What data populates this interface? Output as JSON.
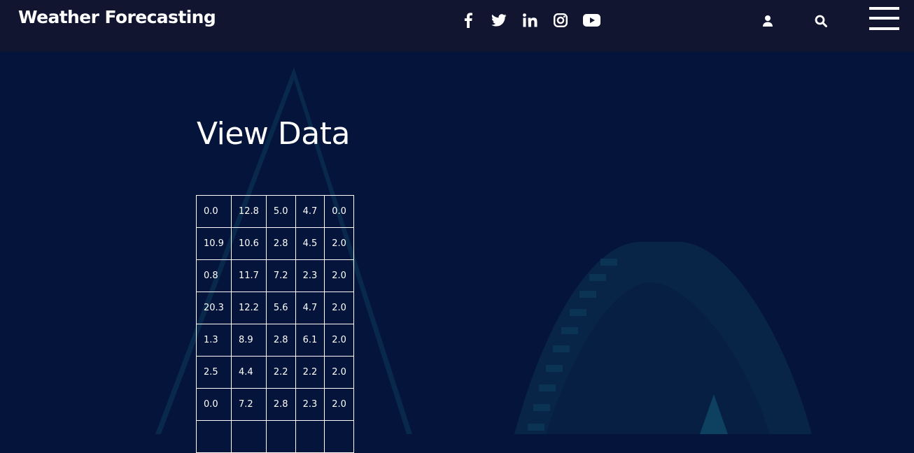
{
  "header": {
    "brand": "Weather Forecasting",
    "social_icons": [
      "facebook-icon",
      "twitter-icon",
      "linkedin-icon",
      "instagram-icon",
      "youtube-icon"
    ],
    "utility_icons": [
      "user-icon",
      "search-icon",
      "menu-icon"
    ]
  },
  "main": {
    "title": "View Data",
    "table": {
      "rows": [
        [
          "0.0",
          "12.8",
          "5.0",
          "4.7",
          "0.0"
        ],
        [
          "10.9",
          "10.6",
          "2.8",
          "4.5",
          "2.0"
        ],
        [
          "0.8",
          "11.7",
          "7.2",
          "2.3",
          "2.0"
        ],
        [
          "20.3",
          "12.2",
          "5.6",
          "4.7",
          "2.0"
        ],
        [
          "1.3",
          "8.9",
          "2.8",
          "6.1",
          "2.0"
        ],
        [
          "2.5",
          "4.4",
          "2.2",
          "2.2",
          "2.0"
        ],
        [
          "0.0",
          "7.2",
          "2.8",
          "2.3",
          "2.0"
        ],
        [
          "",
          "",
          "",
          "",
          ""
        ]
      ]
    }
  },
  "colors": {
    "page_background": "#04143a",
    "header_background": "#11152f",
    "text": "#ffffff",
    "decoration": "#0c3a5a"
  }
}
